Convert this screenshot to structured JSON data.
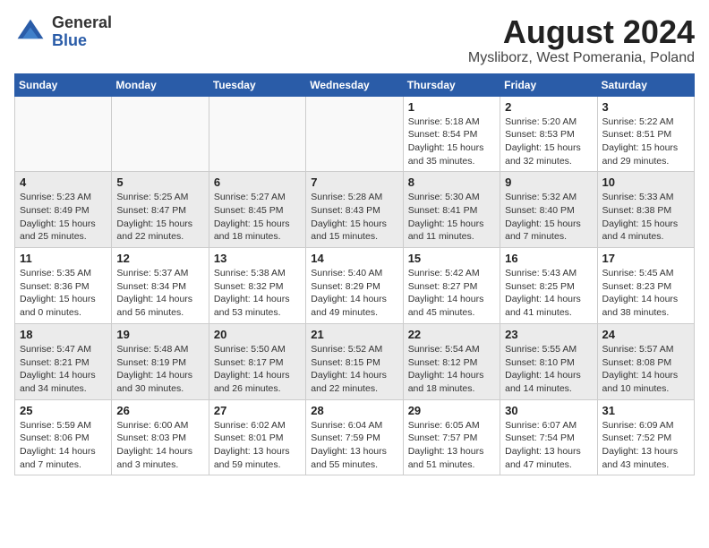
{
  "header": {
    "logo_line1": "General",
    "logo_line2": "Blue",
    "month_title": "August 2024",
    "location": "Mysliborz, West Pomerania, Poland"
  },
  "weekdays": [
    "Sunday",
    "Monday",
    "Tuesday",
    "Wednesday",
    "Thursday",
    "Friday",
    "Saturday"
  ],
  "weeks": [
    [
      {
        "day": "",
        "info": ""
      },
      {
        "day": "",
        "info": ""
      },
      {
        "day": "",
        "info": ""
      },
      {
        "day": "",
        "info": ""
      },
      {
        "day": "1",
        "info": "Sunrise: 5:18 AM\nSunset: 8:54 PM\nDaylight: 15 hours\nand 35 minutes."
      },
      {
        "day": "2",
        "info": "Sunrise: 5:20 AM\nSunset: 8:53 PM\nDaylight: 15 hours\nand 32 minutes."
      },
      {
        "day": "3",
        "info": "Sunrise: 5:22 AM\nSunset: 8:51 PM\nDaylight: 15 hours\nand 29 minutes."
      }
    ],
    [
      {
        "day": "4",
        "info": "Sunrise: 5:23 AM\nSunset: 8:49 PM\nDaylight: 15 hours\nand 25 minutes."
      },
      {
        "day": "5",
        "info": "Sunrise: 5:25 AM\nSunset: 8:47 PM\nDaylight: 15 hours\nand 22 minutes."
      },
      {
        "day": "6",
        "info": "Sunrise: 5:27 AM\nSunset: 8:45 PM\nDaylight: 15 hours\nand 18 minutes."
      },
      {
        "day": "7",
        "info": "Sunrise: 5:28 AM\nSunset: 8:43 PM\nDaylight: 15 hours\nand 15 minutes."
      },
      {
        "day": "8",
        "info": "Sunrise: 5:30 AM\nSunset: 8:41 PM\nDaylight: 15 hours\nand 11 minutes."
      },
      {
        "day": "9",
        "info": "Sunrise: 5:32 AM\nSunset: 8:40 PM\nDaylight: 15 hours\nand 7 minutes."
      },
      {
        "day": "10",
        "info": "Sunrise: 5:33 AM\nSunset: 8:38 PM\nDaylight: 15 hours\nand 4 minutes."
      }
    ],
    [
      {
        "day": "11",
        "info": "Sunrise: 5:35 AM\nSunset: 8:36 PM\nDaylight: 15 hours\nand 0 minutes."
      },
      {
        "day": "12",
        "info": "Sunrise: 5:37 AM\nSunset: 8:34 PM\nDaylight: 14 hours\nand 56 minutes."
      },
      {
        "day": "13",
        "info": "Sunrise: 5:38 AM\nSunset: 8:32 PM\nDaylight: 14 hours\nand 53 minutes."
      },
      {
        "day": "14",
        "info": "Sunrise: 5:40 AM\nSunset: 8:29 PM\nDaylight: 14 hours\nand 49 minutes."
      },
      {
        "day": "15",
        "info": "Sunrise: 5:42 AM\nSunset: 8:27 PM\nDaylight: 14 hours\nand 45 minutes."
      },
      {
        "day": "16",
        "info": "Sunrise: 5:43 AM\nSunset: 8:25 PM\nDaylight: 14 hours\nand 41 minutes."
      },
      {
        "day": "17",
        "info": "Sunrise: 5:45 AM\nSunset: 8:23 PM\nDaylight: 14 hours\nand 38 minutes."
      }
    ],
    [
      {
        "day": "18",
        "info": "Sunrise: 5:47 AM\nSunset: 8:21 PM\nDaylight: 14 hours\nand 34 minutes."
      },
      {
        "day": "19",
        "info": "Sunrise: 5:48 AM\nSunset: 8:19 PM\nDaylight: 14 hours\nand 30 minutes."
      },
      {
        "day": "20",
        "info": "Sunrise: 5:50 AM\nSunset: 8:17 PM\nDaylight: 14 hours\nand 26 minutes."
      },
      {
        "day": "21",
        "info": "Sunrise: 5:52 AM\nSunset: 8:15 PM\nDaylight: 14 hours\nand 22 minutes."
      },
      {
        "day": "22",
        "info": "Sunrise: 5:54 AM\nSunset: 8:12 PM\nDaylight: 14 hours\nand 18 minutes."
      },
      {
        "day": "23",
        "info": "Sunrise: 5:55 AM\nSunset: 8:10 PM\nDaylight: 14 hours\nand 14 minutes."
      },
      {
        "day": "24",
        "info": "Sunrise: 5:57 AM\nSunset: 8:08 PM\nDaylight: 14 hours\nand 10 minutes."
      }
    ],
    [
      {
        "day": "25",
        "info": "Sunrise: 5:59 AM\nSunset: 8:06 PM\nDaylight: 14 hours\nand 7 minutes."
      },
      {
        "day": "26",
        "info": "Sunrise: 6:00 AM\nSunset: 8:03 PM\nDaylight: 14 hours\nand 3 minutes."
      },
      {
        "day": "27",
        "info": "Sunrise: 6:02 AM\nSunset: 8:01 PM\nDaylight: 13 hours\nand 59 minutes."
      },
      {
        "day": "28",
        "info": "Sunrise: 6:04 AM\nSunset: 7:59 PM\nDaylight: 13 hours\nand 55 minutes."
      },
      {
        "day": "29",
        "info": "Sunrise: 6:05 AM\nSunset: 7:57 PM\nDaylight: 13 hours\nand 51 minutes."
      },
      {
        "day": "30",
        "info": "Sunrise: 6:07 AM\nSunset: 7:54 PM\nDaylight: 13 hours\nand 47 minutes."
      },
      {
        "day": "31",
        "info": "Sunrise: 6:09 AM\nSunset: 7:52 PM\nDaylight: 13 hours\nand 43 minutes."
      }
    ]
  ]
}
